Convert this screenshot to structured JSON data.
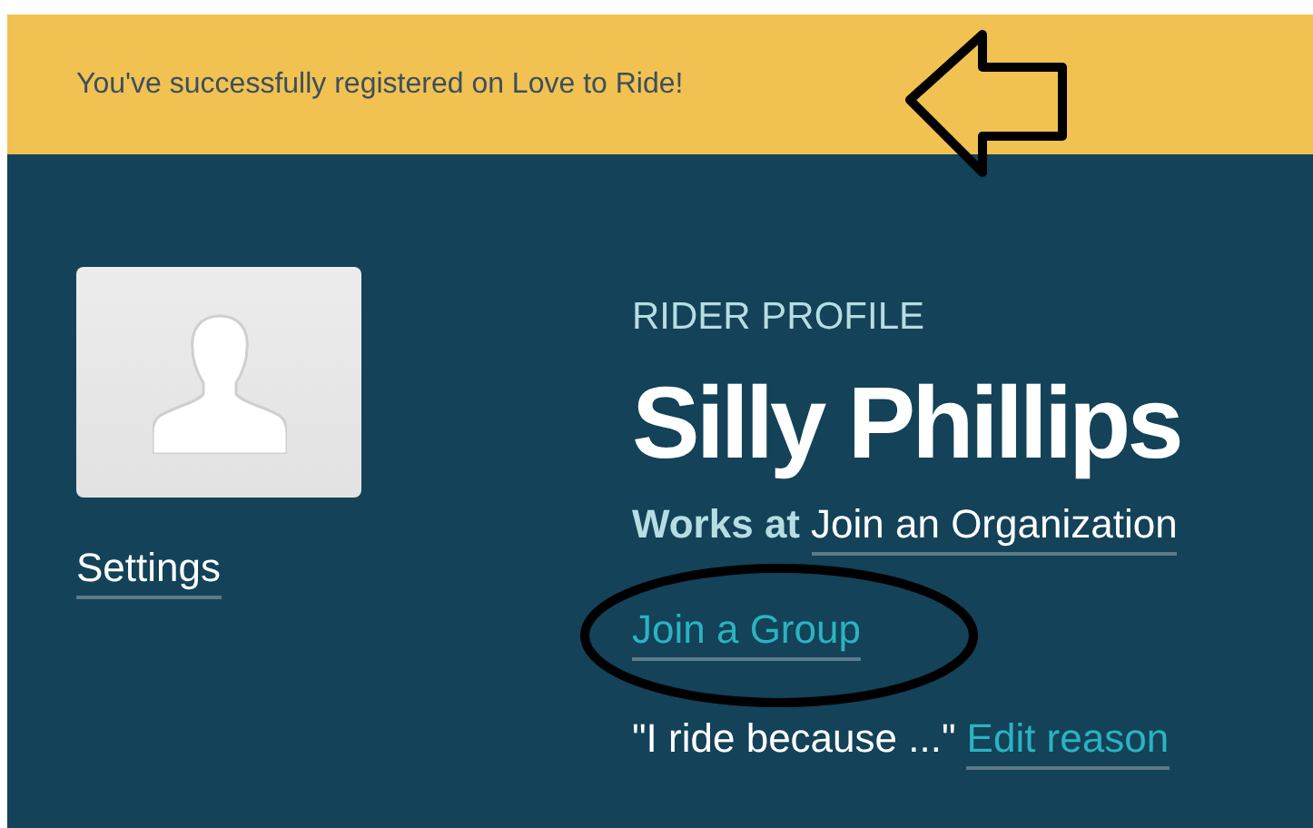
{
  "banner": {
    "message": "You've successfully registered on Love to Ride!"
  },
  "sidebar": {
    "settings_link": "Settings"
  },
  "profile": {
    "heading": "RIDER PROFILE",
    "name": "Silly Phillips",
    "works_at_label": "Works at",
    "organization_link": "Join an Organization",
    "group_link": "Join a Group",
    "reason_text": "\"I ride because ...\"",
    "reason_link": "Edit reason"
  }
}
